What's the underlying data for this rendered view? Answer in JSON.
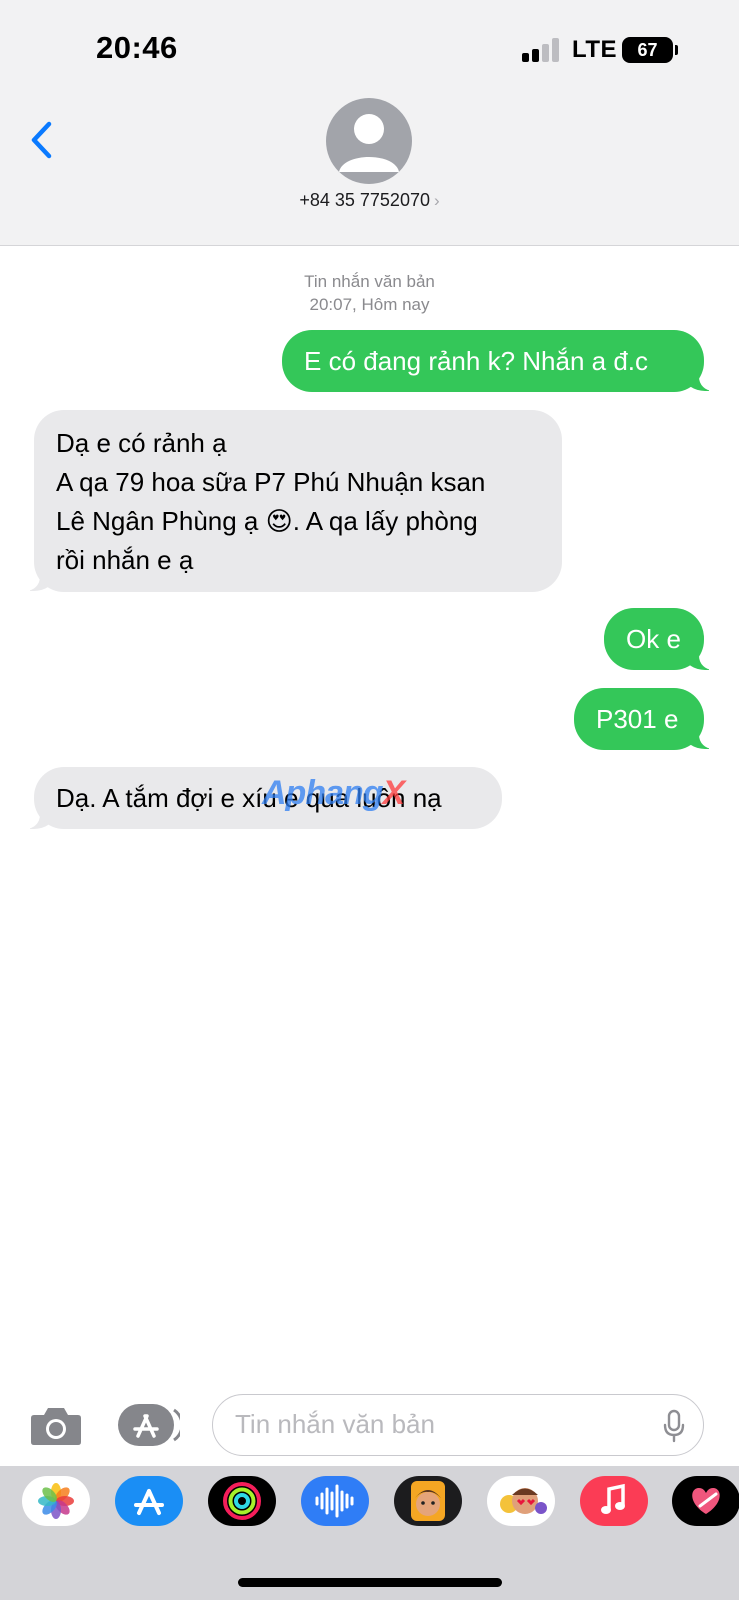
{
  "status_bar": {
    "time": "20:46",
    "network": "LTE",
    "battery": "67"
  },
  "header": {
    "contact": "+84 35 7752070",
    "chevron": "›"
  },
  "thread": {
    "meta_line1": "Tin nhắn văn bản",
    "meta_line2": "20:07, Hôm nay",
    "messages": [
      {
        "direction": "outgoing",
        "text": "E có đang rảnh k? Nhắn a đ.c"
      },
      {
        "direction": "incoming",
        "text": "Dạ e có rảnh ạ\nA qa 79 hoa sữa P7 Phú Nhuận ksan\nLê Ngân Phùng ạ 😍. A qa lấy phòng\nrồi nhắn e ạ"
      },
      {
        "direction": "outgoing",
        "text": "Ok e"
      },
      {
        "direction": "outgoing",
        "text": "P301 e"
      },
      {
        "direction": "incoming",
        "text": "Dạ. A tắm đợi e xíu e qua luôn nạ"
      }
    ]
  },
  "watermark": {
    "text": "Aphang",
    "x": "X"
  },
  "composer": {
    "placeholder": "Tin nhắn văn bản"
  },
  "app_strip": [
    "photos-icon",
    "app-store-icon",
    "fitness-icon",
    "audio-message-icon",
    "memoji-icon",
    "memoji-stickers-icon",
    "music-icon",
    "digital-touch-icon"
  ],
  "colors": {
    "outgoing_bubble": "#34c759",
    "incoming_bubble": "#e9e9eb",
    "accent": "#0a7aff",
    "header_bg": "#f2f2f3"
  }
}
